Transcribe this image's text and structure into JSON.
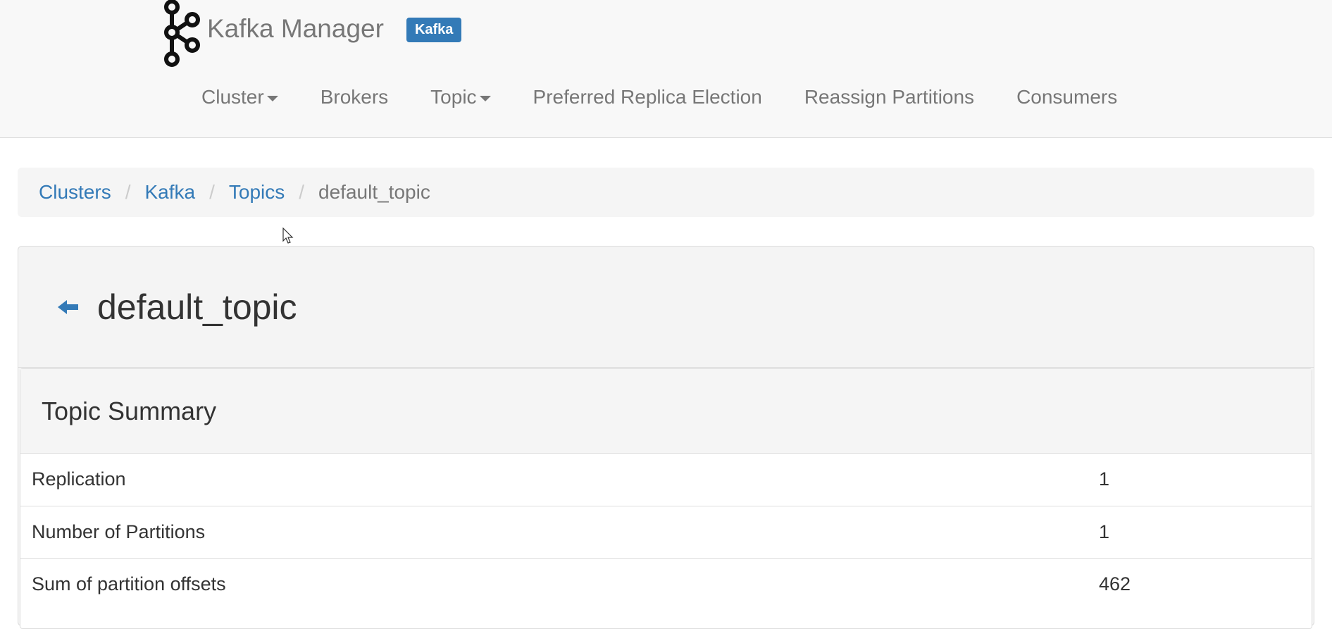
{
  "brand": {
    "title": "Kafka Manager",
    "badge": "Kafka",
    "logo_icon": "kafka-logo-icon"
  },
  "nav": {
    "items": [
      {
        "label": "Cluster",
        "has_dropdown": true
      },
      {
        "label": "Brokers",
        "has_dropdown": false
      },
      {
        "label": "Topic",
        "has_dropdown": true
      },
      {
        "label": "Preferred Replica Election",
        "has_dropdown": false
      },
      {
        "label": "Reassign Partitions",
        "has_dropdown": false
      },
      {
        "label": "Consumers",
        "has_dropdown": false
      }
    ]
  },
  "breadcrumb": {
    "items": [
      "Clusters",
      "Kafka",
      "Topics"
    ],
    "current": "default_topic",
    "separator": "/"
  },
  "panel": {
    "back_icon": "arrow-left-icon",
    "title": "default_topic",
    "summary": {
      "heading": "Topic Summary",
      "rows": [
        {
          "label": "Replication",
          "value": "1"
        },
        {
          "label": "Number of Partitions",
          "value": "1"
        },
        {
          "label": "Sum of partition offsets",
          "value": "462"
        }
      ]
    }
  },
  "colors": {
    "link": "#337ab7",
    "badge": "#337ab7",
    "navbar_bg": "#f8f8f8",
    "nav_text": "#777777"
  }
}
